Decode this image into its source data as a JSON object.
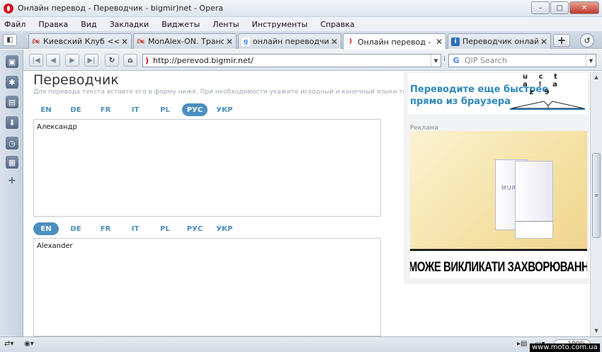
{
  "window": {
    "title": "Онлайн перевод - Переводчик - bigmir)net - Opera",
    "min_label": "–",
    "max_label": "□",
    "close_label": "✕"
  },
  "menu": [
    "Файл",
    "Правка",
    "Вид",
    "Закладки",
    "Виджеты",
    "Ленты",
    "Инструменты",
    "Справка"
  ],
  "tabs": [
    {
      "label": "Киевский Клуб <<Mu...",
      "icon": "bike-icon",
      "active": false
    },
    {
      "label": "MonAlex-ON. Трансп...",
      "icon": "bike-icon",
      "active": false
    },
    {
      "label": "онлайн переводчик -...",
      "icon": "google-icon",
      "active": false
    },
    {
      "label": "Онлайн перевод - Пе...",
      "icon": "bigmir-icon",
      "active": true
    },
    {
      "label": "Переводчик онлайн, ...",
      "icon": "info-icon",
      "active": false
    }
  ],
  "address": {
    "url": "http://perevod.bigmir.net/",
    "search_placeholder": "QIP Search"
  },
  "page": {
    "title": "Переводчик",
    "subtitle": "Для перевода текста вставте его в форму ниже. При необходимости укажите исходный и конечный языки текста.",
    "source_langs": [
      "EN",
      "DE",
      "FR",
      "IT",
      "PL",
      "РУС",
      "УКР"
    ],
    "source_active": "РУС",
    "source_text": "Александр",
    "target_langs": [
      "EN",
      "DE",
      "FR",
      "IT",
      "PL",
      "РУС",
      "УКР"
    ],
    "target_active": "EN",
    "target_text": "Alexander"
  },
  "ad": {
    "banner_line1": "Переводите еще быстрее",
    "banner_line2": "прямо из браузера",
    "label": "Реклама",
    "brand": "MURATTI",
    "warning": "КУРІННЯ МОЖЕ ВИКЛИКАТИ ЗАХВОРЮВАННЯ НА РАК"
  },
  "status": {
    "zoom": "100%"
  },
  "watermark": "www.moto.com.ua"
}
